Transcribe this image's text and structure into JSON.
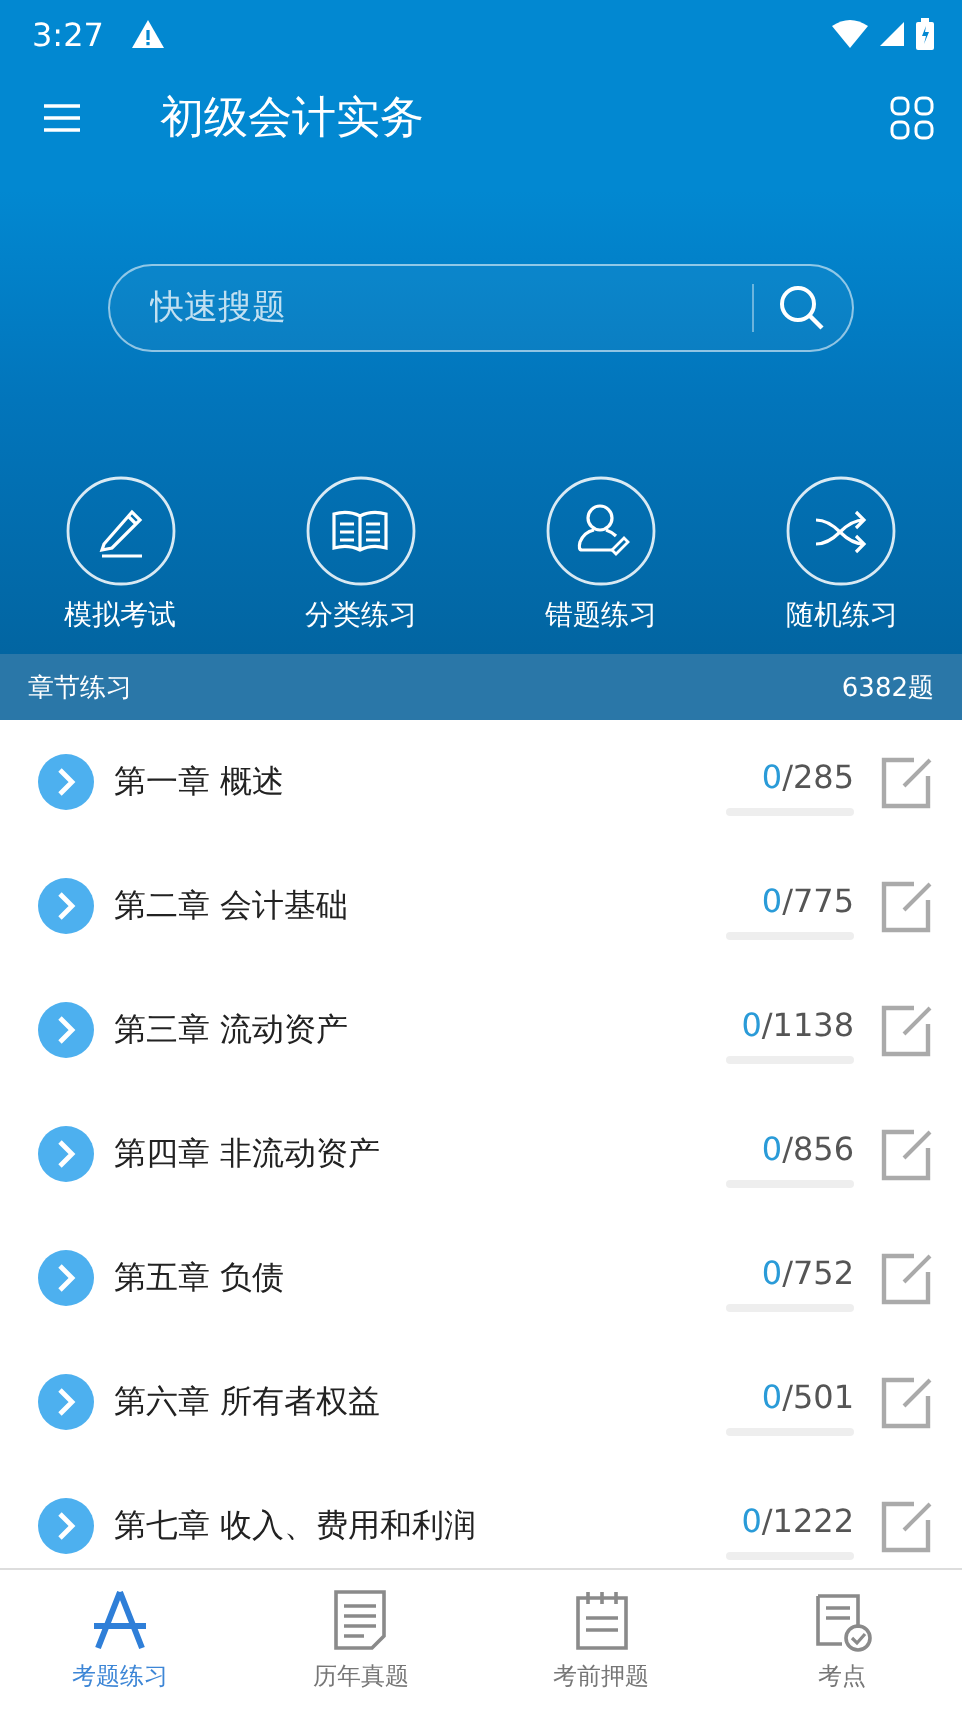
{
  "status_bar": {
    "time": "3:27"
  },
  "app_bar": {
    "title": "初级会计实务"
  },
  "search": {
    "placeholder": "快速搜题"
  },
  "shortcuts": [
    {
      "kind": "pen",
      "label": "模拟考试"
    },
    {
      "kind": "book",
      "label": "分类练习"
    },
    {
      "kind": "user",
      "label": "错题练习"
    },
    {
      "kind": "shuffle",
      "label": "随机练习"
    }
  ],
  "section": {
    "title": "章节练习",
    "count": "6382题"
  },
  "chapters": [
    {
      "title": "第一章 概述",
      "done": "0",
      "total": "/285",
      "level": 0
    },
    {
      "title": "第二章 会计基础",
      "done": "0",
      "total": "/775",
      "level": 0
    },
    {
      "title": "第三章 流动资产",
      "done": "0",
      "total": "/1138",
      "level": 0
    },
    {
      "title": "第四章 非流动资产",
      "done": "0",
      "total": "/856",
      "level": 0
    },
    {
      "title": "第五章 负债",
      "done": "0",
      "total": "/752",
      "level": 0
    },
    {
      "title": "第六章 所有者权益",
      "done": "0",
      "total": "/501",
      "level": 0
    },
    {
      "title": "第七章 收入、费用和利润",
      "done": "0",
      "total": "/1222",
      "level": 0
    }
  ],
  "bottom_nav": [
    {
      "kind": "compass",
      "label": "考题练习",
      "selected": true
    },
    {
      "kind": "paper",
      "label": "历年真题",
      "selected": false
    },
    {
      "kind": "board",
      "label": "考前押题",
      "selected": false
    },
    {
      "kind": "check",
      "label": "考点",
      "selected": false
    }
  ]
}
